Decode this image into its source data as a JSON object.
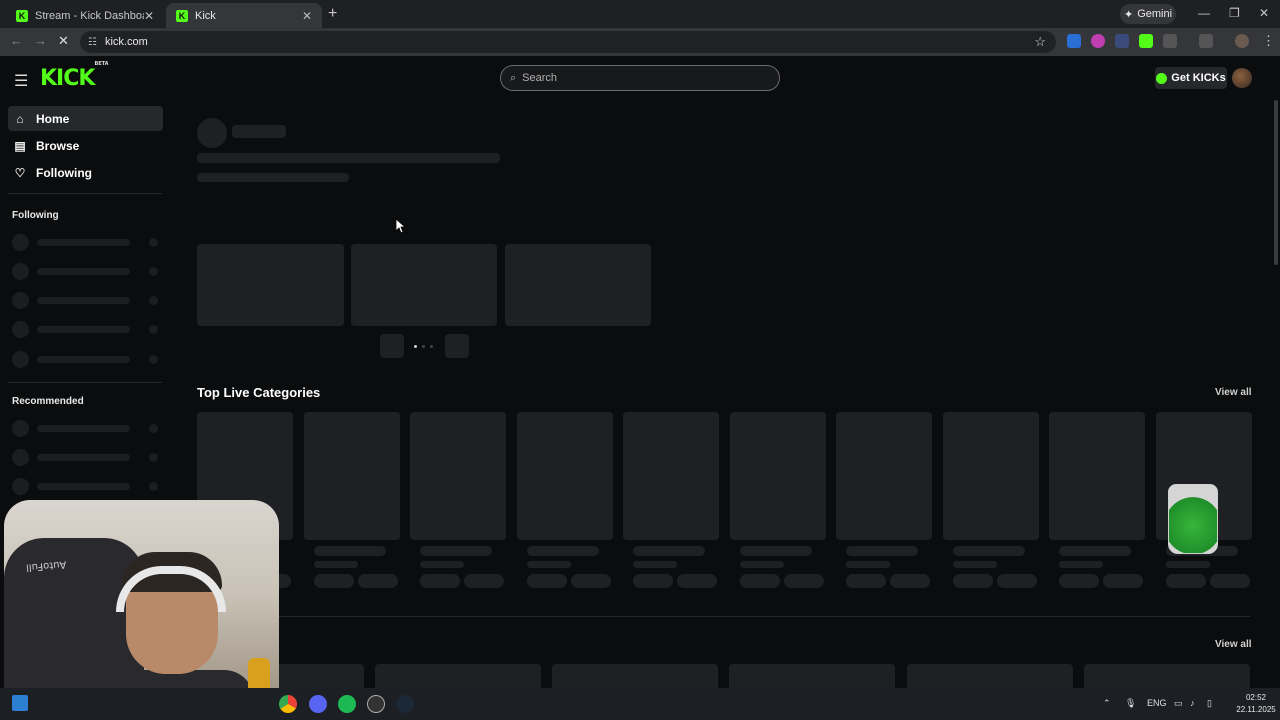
{
  "browser": {
    "tabs": [
      {
        "label": "Stream - Kick Dashboard",
        "favicon": "K"
      },
      {
        "label": "Kick",
        "favicon": "K"
      }
    ],
    "gemini_label": "Gemini",
    "url": "kick.com"
  },
  "header": {
    "logo_text": "KICK",
    "logo_badge": "BETA",
    "search_placeholder": "Search",
    "get_kicks_label": "Get KICKs"
  },
  "sidebar": {
    "nav": [
      {
        "label": "Home",
        "icon": "home-icon"
      },
      {
        "label": "Browse",
        "icon": "browse-icon"
      },
      {
        "label": "Following",
        "icon": "heart-icon"
      }
    ],
    "following_heading": "Following",
    "recommended_heading": "Recommended"
  },
  "main": {
    "top_categories_title": "Top Live Categories",
    "view_all_label": "View all",
    "view_all_label_2": "View all"
  },
  "webcam": {
    "chair_brand": "AutoFull"
  },
  "taskbar": {
    "language": "ENG",
    "time": "02:52",
    "date": "22.11.2025"
  },
  "colors": {
    "brand_green": "#53fc18",
    "background": "#0b0c0d",
    "skeleton": "#1f2023"
  }
}
